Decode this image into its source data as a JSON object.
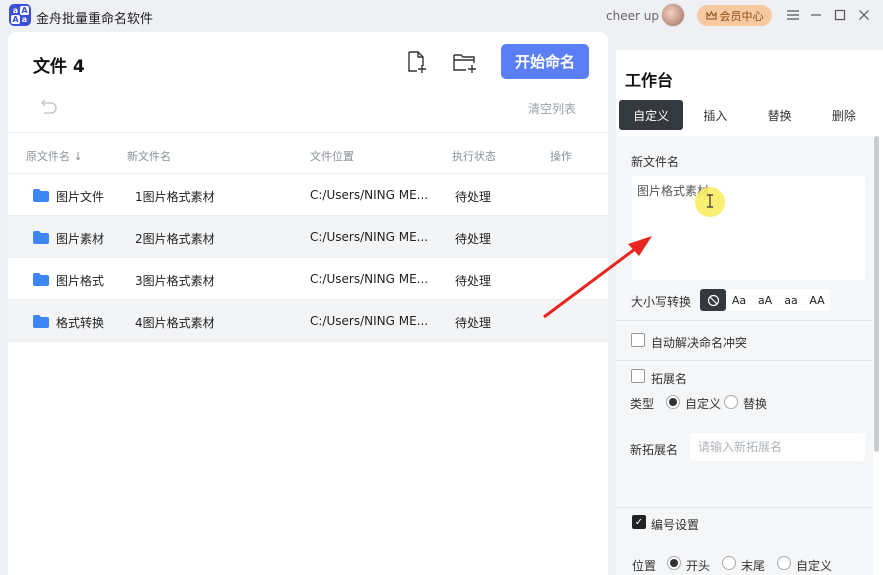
{
  "app": {
    "title": "金舟批量重命名软件",
    "logo_glyphs": [
      "a",
      "A",
      "A",
      "a"
    ],
    "user_name": "cheer up",
    "vip_label": "会员中心"
  },
  "toolbar": {
    "file_count_label": "文件 4",
    "start_label": "开始命名",
    "clear_label": "清空列表"
  },
  "table": {
    "headers": [
      "原文件名 ↓",
      "新文件名",
      "文件位置",
      "执行状态",
      "操作"
    ],
    "rows": [
      {
        "original": "图片文件",
        "new_name": "1图片格式素材",
        "location": "C:/Users/NING ME...",
        "status": "待处理"
      },
      {
        "original": "图片素材",
        "new_name": "2图片格式素材",
        "location": "C:/Users/NING ME...",
        "status": "待处理"
      },
      {
        "original": "图片格式",
        "new_name": "3图片格式素材",
        "location": "C:/Users/NING ME...",
        "status": "待处理"
      },
      {
        "original": "格式转换",
        "new_name": "4图片格式素材",
        "location": "C:/Users/NING ME...",
        "status": "待处理"
      }
    ]
  },
  "workbench": {
    "title": "工作台",
    "tabs": [
      "自定义",
      "插入",
      "替换",
      "删除"
    ],
    "new_name_label": "新文件名",
    "new_name_value": "图片格式素材",
    "case_label": "大小写转换",
    "case_options": [
      "Aa",
      "aA",
      "aa",
      "AA"
    ],
    "auto_resolve_label": "自动解决命名冲突",
    "extension_label": "拓展名",
    "type_label": "类型",
    "type_options": [
      "自定义",
      "替换"
    ],
    "new_ext_label": "新拓展名",
    "new_ext_placeholder": "请输入新拓展名",
    "numbering_label": "编号设置",
    "position_label": "位置",
    "position_options": [
      "开头",
      "末尾",
      "自定义"
    ]
  },
  "colors": {
    "accent": "#5b7ef5",
    "dark": "#34383f",
    "annotation_arrow": "#e8261f",
    "vip": "#f6c9a0",
    "folder": "#3d86f5"
  }
}
